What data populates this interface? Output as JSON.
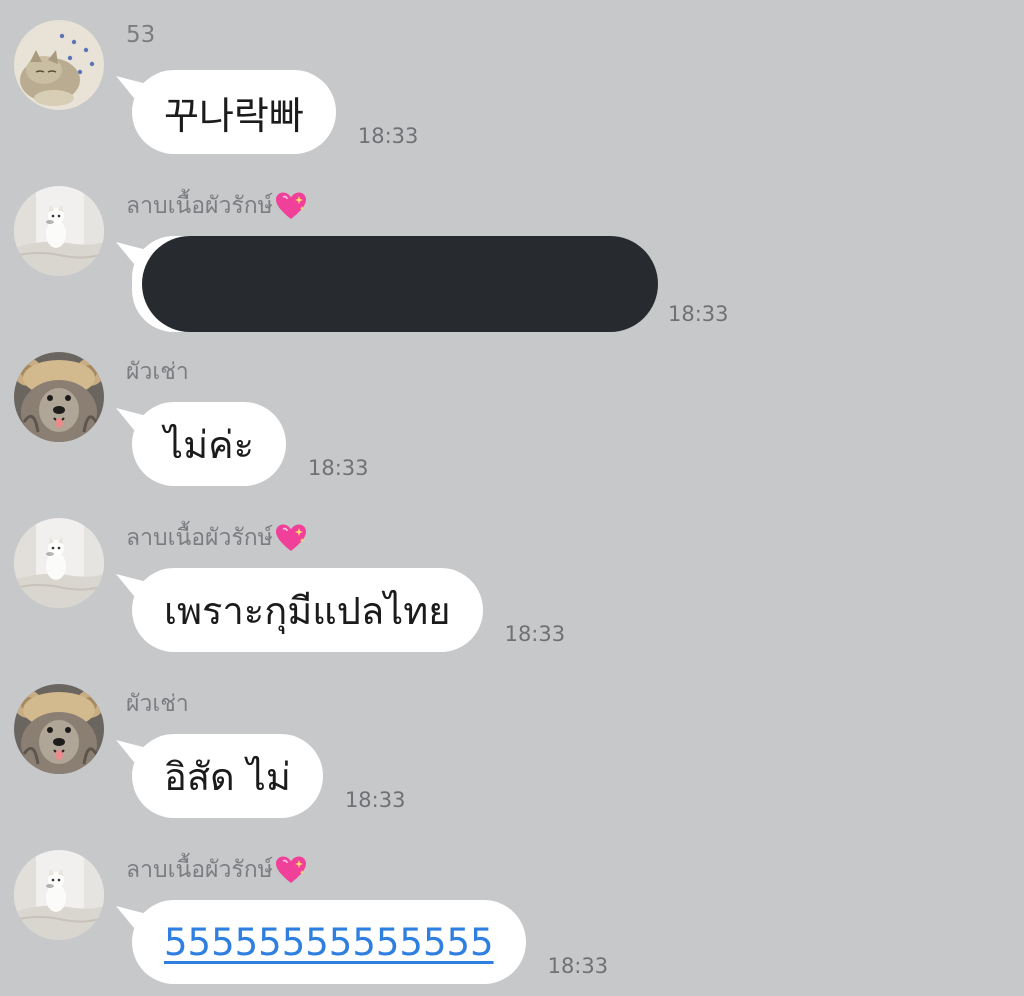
{
  "messages": [
    {
      "sender": "53",
      "text": "꾸나락빠",
      "time": "18:33",
      "avatar_icon": "cat-lying-icon",
      "heart": false,
      "type": "text"
    },
    {
      "sender": "ลาบเนื้อผัวรักษ์",
      "text": "",
      "time": "18:33",
      "avatar_icon": "white-cat-icon",
      "heart": true,
      "type": "redacted"
    },
    {
      "sender": "ผัวเช่า",
      "text": "ไม่ค่ะ",
      "time": "18:33",
      "avatar_icon": "dog-bear-hat-icon",
      "heart": false,
      "type": "text"
    },
    {
      "sender": "ลาบเนื้อผัวรักษ์",
      "text": "เพราะกุมีแปลไทย",
      "time": "18:33",
      "avatar_icon": "white-cat-icon",
      "heart": true,
      "type": "text"
    },
    {
      "sender": "ผัวเช่า",
      "text": "อิสัด ไม่",
      "time": "18:33",
      "avatar_icon": "dog-bear-hat-icon",
      "heart": false,
      "type": "text"
    },
    {
      "sender": "ลาบเนื้อผัวรักษ์",
      "text": "55555555555555",
      "time": "18:33",
      "avatar_icon": "white-cat-icon",
      "heart": true,
      "type": "link"
    }
  ],
  "colors": {
    "background": "#c7c8ca",
    "bubble": "#ffffff",
    "link": "#2f7fe0",
    "redaction": "#272b30",
    "heart": "#f0409a"
  }
}
